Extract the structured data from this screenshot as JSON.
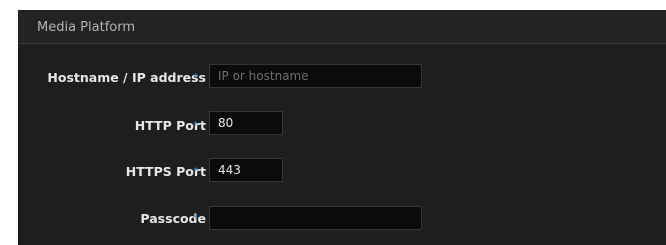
{
  "section": {
    "title": "Media Platform"
  },
  "form": {
    "required_marker": "*",
    "hostname": {
      "label": "Hostname / IP address",
      "value": "",
      "placeholder": "IP or hostname"
    },
    "http_port": {
      "label": "HTTP Port",
      "value": "80",
      "placeholder": ""
    },
    "https_port": {
      "label": "HTTPS Port",
      "value": "443",
      "placeholder": ""
    },
    "passcode": {
      "label": "Passcode",
      "value": "",
      "placeholder": ""
    }
  },
  "colors": {
    "panel_background": "#1e1e1e",
    "input_background": "#0b0b0b",
    "required_marker": "#3b7fc4",
    "label_text": "#e6e6e6",
    "title_text": "#b4b4b4"
  }
}
